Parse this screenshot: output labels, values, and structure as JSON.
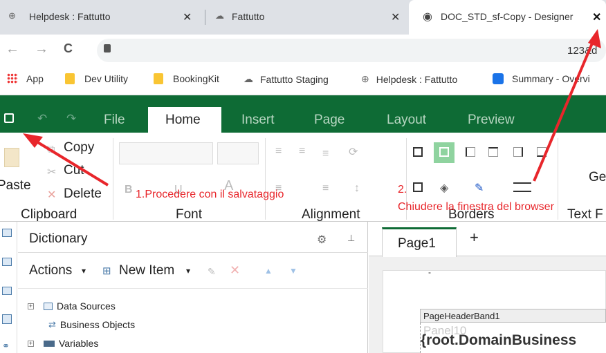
{
  "browser": {
    "tabs": [
      {
        "title": "Helpdesk : Fattutto",
        "close": "✕"
      },
      {
        "title": "Fattutto",
        "close": "✕"
      },
      {
        "title": "DOC_STD_sf-Copy - Designer",
        "close": "✕"
      }
    ],
    "nav": {
      "back": "←",
      "forward": "→",
      "reload": "C",
      "lock": "🔒",
      "url_tail": "123&d"
    },
    "bookmarks": [
      {
        "label": "App"
      },
      {
        "label": "Dev Utility"
      },
      {
        "label": "BookingKit"
      },
      {
        "label": "Fattutto Staging"
      },
      {
        "label": "Helpdesk : Fattutto"
      },
      {
        "label": "Summary - Overvi"
      }
    ]
  },
  "designer": {
    "menu": {
      "save": "▪",
      "undo": "↶",
      "redo": "↷",
      "file": "File",
      "home": "Home",
      "insert": "Insert",
      "page": "Page",
      "layout": "Layout",
      "preview": "Preview"
    },
    "ribbon": {
      "paste": "Paste",
      "copy": "Copy",
      "cut": "Cut",
      "delete": "Delete",
      "groups": {
        "clipboard": "Clipboard",
        "font": "Font",
        "alignment": "Alignment",
        "borders": "Borders",
        "text_format": "Text F"
      },
      "ge": "Ge"
    },
    "dictionary": {
      "title": "Dictionary",
      "actions": "Actions",
      "new_item": "New Item",
      "tree": [
        {
          "label": "Data Sources"
        },
        {
          "label": "Business Objects"
        },
        {
          "label": "Variables"
        }
      ]
    },
    "page": {
      "tab": "Page1",
      "add": "+",
      "band": "PageHeaderBand1",
      "panel": "Panel10",
      "expr": "{root.DomainBusiness"
    }
  },
  "annotations": {
    "step1": "1.Procedere con il salvataggio",
    "step2_num": "2.",
    "step2": "Chiudere la finestra del browser",
    "color": "#e8262b"
  }
}
